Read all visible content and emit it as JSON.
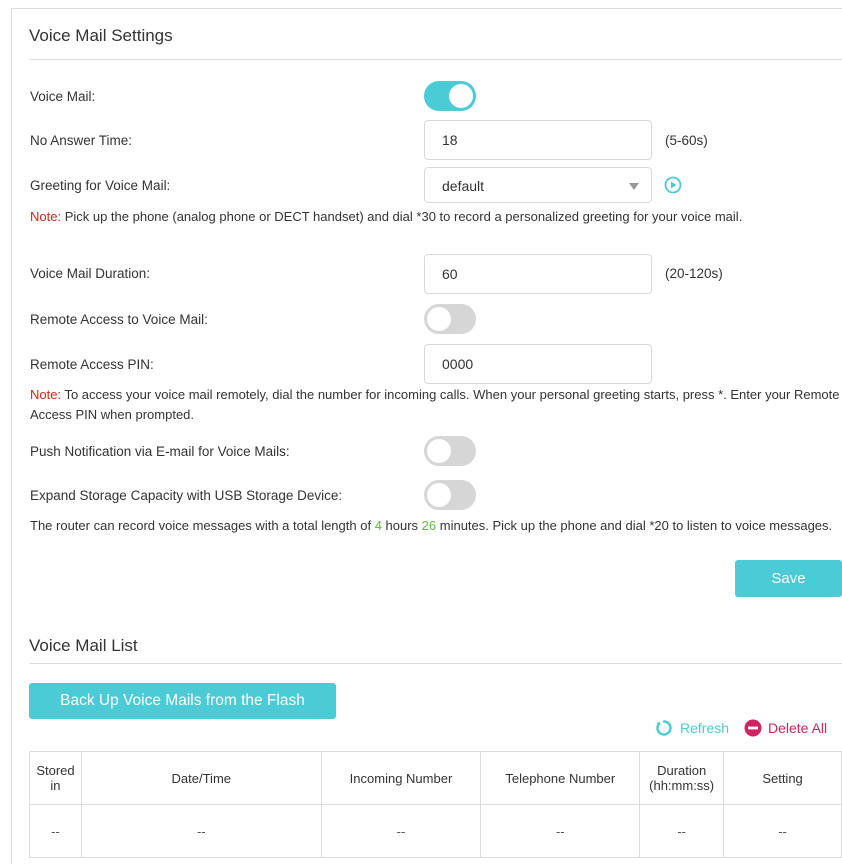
{
  "settings": {
    "title": "Voice Mail Settings",
    "voice_mail": {
      "label": "Voice Mail:",
      "enabled": true
    },
    "no_answer_time": {
      "label": "No Answer Time:",
      "value": "18",
      "hint": "(5-60s)"
    },
    "greeting": {
      "label": "Greeting for Voice Mail:",
      "value": "default",
      "play_icon": "play-circle-icon"
    },
    "note1": {
      "prefix": "Note:",
      "text": " Pick up the phone (analog phone or DECT handset) and dial *30 to record a personalized greeting for your voice mail."
    },
    "duration": {
      "label": "Voice Mail Duration:",
      "value": "60",
      "hint": "(20-120s)"
    },
    "remote_access": {
      "label": "Remote Access to Voice Mail:",
      "enabled": false
    },
    "remote_pin": {
      "label": "Remote Access PIN:",
      "value": "0000"
    },
    "note2": {
      "prefix": "Note:",
      "text": " To access your voice mail remotely, dial the number for incoming calls. When your personal greeting starts, press *. Enter your Remote Access PIN when prompted."
    },
    "push_notification": {
      "label": "Push Notification via E-mail for Voice Mails:",
      "enabled": false
    },
    "expand_storage": {
      "label": "Expand Storage Capacity with USB Storage Device:",
      "enabled": false
    },
    "capacity": {
      "text_before": "The router can record voice messages with a total length of ",
      "hours": "4",
      "text_hours": " hours ",
      "minutes": "26",
      "text_after": " minutes. Pick up the phone and dial *20 to listen to voice messages."
    },
    "save_label": "Save"
  },
  "list": {
    "title": "Voice Mail List",
    "backup_label": "Back Up Voice Mails from the Flash",
    "refresh_label": "Refresh",
    "delete_all_label": "Delete All",
    "columns": [
      "Stored in",
      "Date/Time",
      "Incoming Number",
      "Telephone Number",
      "Duration (hh:mm:ss)",
      "Setting"
    ],
    "rows": [
      [
        "--",
        "--",
        "--",
        "--",
        "--",
        "--"
      ]
    ]
  },
  "colors": {
    "accent": "#4acbd6",
    "note_red": "#e0211d",
    "green": "#5dbb3e",
    "delete": "#d0245f"
  }
}
